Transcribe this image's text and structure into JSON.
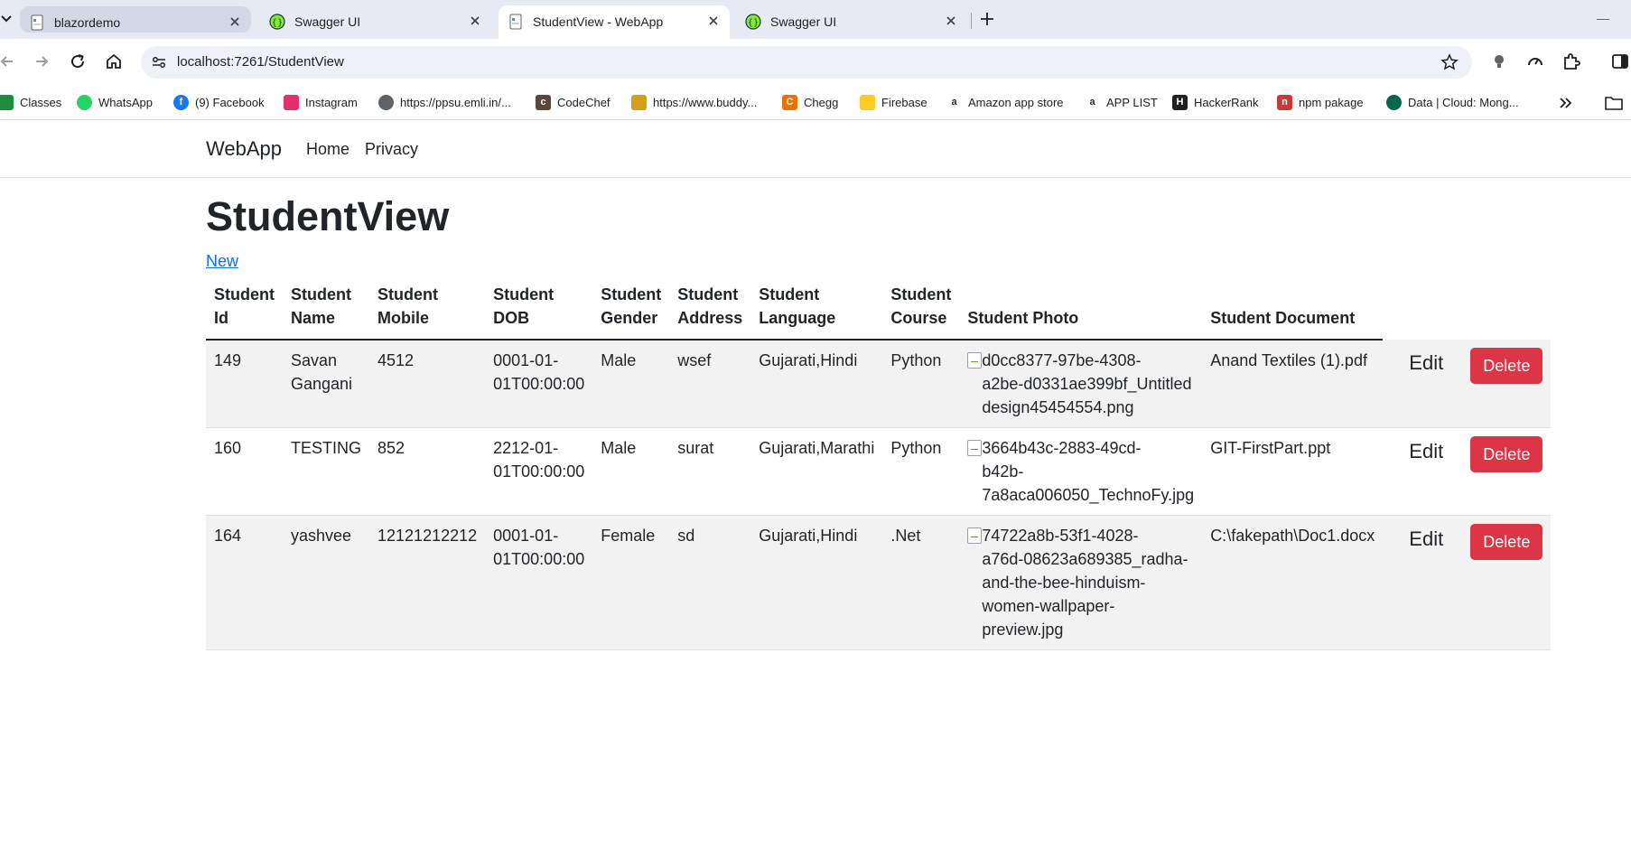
{
  "browser": {
    "tabs": [
      {
        "title": "blazordemo",
        "state": "hover"
      },
      {
        "title": "Swagger UI",
        "state": "inactive"
      },
      {
        "title": "StudentView - WebApp",
        "state": "active"
      },
      {
        "title": "Swagger UI",
        "state": "inactive"
      }
    ],
    "url": "localhost:7261/StudentView",
    "bookmarks": [
      {
        "label": "Classes",
        "icon": "classroom-icon",
        "color": "#1e8e3e"
      },
      {
        "label": "WhatsApp",
        "icon": "whatsapp-icon",
        "color": "#25d366"
      },
      {
        "label": "(9) Facebook",
        "icon": "facebook-icon",
        "color": "#1877f2"
      },
      {
        "label": "Instagram",
        "icon": "instagram-icon",
        "color": "#e1306c"
      },
      {
        "label": "https://ppsu.emli.in/...",
        "icon": "globe-icon",
        "color": "#5f6368"
      },
      {
        "label": "CodeChef",
        "icon": "codechef-icon",
        "color": "#5b4638"
      },
      {
        "label": "https://www.buddy...",
        "icon": "graduation-cap-icon",
        "color": "#d4a017"
      },
      {
        "label": "Chegg",
        "icon": "chegg-icon",
        "color": "#eb7100"
      },
      {
        "label": "Firebase",
        "icon": "firebase-icon",
        "color": "#ffca28"
      },
      {
        "label": "Amazon app store",
        "icon": "amazon-icon",
        "color": "#232f3e"
      },
      {
        "label": "APP LIST",
        "icon": "amazon-icon",
        "color": "#232f3e"
      },
      {
        "label": "HackerRank",
        "icon": "hackerrank-icon",
        "color": "#1ba94c"
      },
      {
        "label": "npm pakage",
        "icon": "npm-icon",
        "color": "#cb3837"
      },
      {
        "label": "Data | Cloud: Mong...",
        "icon": "mongodb-icon",
        "color": "#00684a"
      }
    ]
  },
  "nav": {
    "brand": "WebApp",
    "links": [
      "Home",
      "Privacy"
    ]
  },
  "page": {
    "title": "StudentView",
    "new_link": "New",
    "headers": {
      "id": [
        "Student",
        "Id"
      ],
      "name": [
        "Student",
        "Name"
      ],
      "mobile": [
        "Student",
        "Mobile"
      ],
      "dob": [
        "Student",
        "DOB"
      ],
      "gender": [
        "Student",
        "Gender"
      ],
      "address": [
        "Student",
        "Address"
      ],
      "language": [
        "Student",
        "Language"
      ],
      "course": [
        "Student",
        "Course"
      ],
      "photo": "Student Photo",
      "document": "Student Document"
    },
    "edit_label": "Edit",
    "delete_label": "Delete",
    "rows": [
      {
        "id": "149",
        "name": [
          "Savan",
          "Gangani"
        ],
        "mobile": "4512",
        "dob": [
          "0001-01-",
          "01T00:00:00"
        ],
        "gender": "Male",
        "address": "wsef",
        "language": "Gujarati,Hindi",
        "course": "Python",
        "photo": [
          "d0cc8377-97be-4308-",
          "a2be-d0331ae399bf_Untitled",
          "design45454554.png"
        ],
        "document": "Anand Textiles (1).pdf"
      },
      {
        "id": "160",
        "name": [
          "TESTING"
        ],
        "mobile": "852",
        "dob": [
          "2212-01-",
          "01T00:00:00"
        ],
        "gender": "Male",
        "address": "surat",
        "language": "Gujarati,Marathi",
        "course": "Python",
        "photo": [
          "3664b43c-2883-49cd-",
          "b42b-",
          "7a8aca006050_TechnoFy.jpg"
        ],
        "document": "GIT-FirstPart.ppt"
      },
      {
        "id": "164",
        "name": [
          "yashvee"
        ],
        "mobile": "12121212212",
        "dob": [
          "0001-01-",
          "01T00:00:00"
        ],
        "gender": "Female",
        "address": "sd",
        "language": "Gujarati,Hindi",
        "course": ".Net",
        "photo": [
          "74722a8b-53f1-4028-",
          "a76d-08623a689385_radha-",
          "and-the-bee-hinduism-",
          "women-wallpaper-",
          "preview.jpg"
        ],
        "document": "C:\\fakepath\\Doc1.docx"
      }
    ]
  },
  "colors": {
    "delete_button": "#dc3545",
    "link": "#0d6efd",
    "striped_row": "#f2f2f2"
  }
}
